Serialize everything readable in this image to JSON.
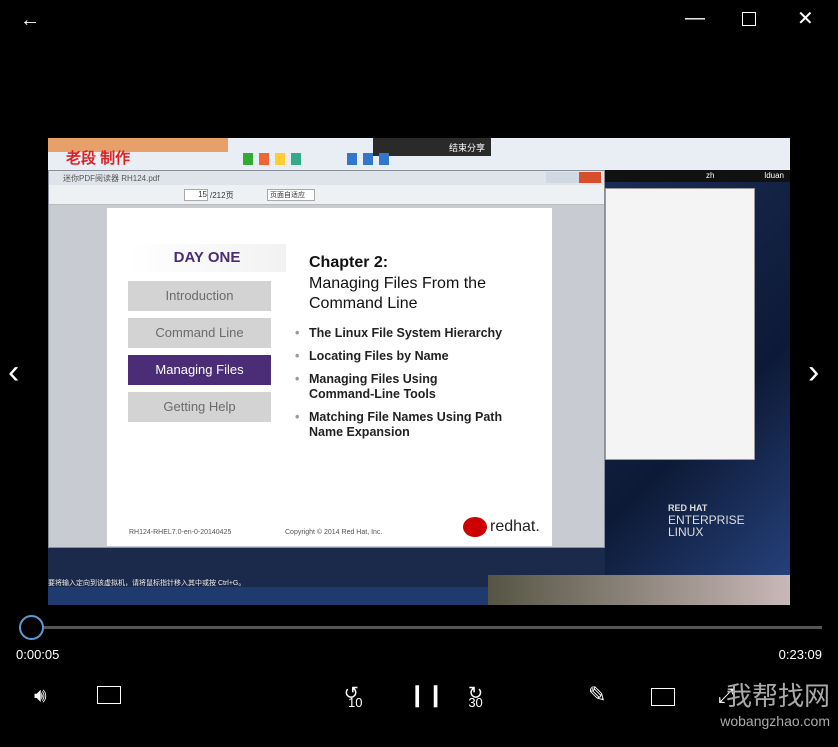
{
  "window": {
    "back_icon": "arrow-left",
    "minimize_icon": "minimize",
    "maximize_icon": "maximize",
    "close_icon": "close"
  },
  "video": {
    "watermark": "老段 制作",
    "share_toolbar": {
      "end_share": "结束分享"
    },
    "pdf_viewer": {
      "title": "迷你PDF阅读器  RH124.pdf",
      "page_current": "15",
      "page_total": "/212页",
      "zoom_mode": "页面自适应"
    },
    "slide": {
      "day_label": "DAY ONE",
      "nav": [
        "Introduction",
        "Command Line",
        "Managing Files",
        "Getting Help"
      ],
      "active_nav": "Managing Files",
      "chapter": "Chapter 2:",
      "title": "Managing Files From the Command Line",
      "bullets": [
        "The Linux File System Hierarchy",
        "Locating Files by Name",
        "Managing Files Using Command-Line Tools",
        "Matching File Names Using Path Name Expansion"
      ],
      "footer_left": "RH124-RHEL7.0-en-0-20140425",
      "footer_center": "Copyright © 2014 Red Hat, Inc.",
      "logo": "redhat."
    },
    "desktop": {
      "lang": "zh",
      "user": "lduan",
      "rhel_logo": [
        "RED HAT",
        "ENTERPRISE",
        "LINUX"
      ]
    },
    "status_text": "要将输入定向到该虚拟机，请将鼠标指针移入其中或按 Ctrl+G。"
  },
  "player": {
    "current_time": "0:00:05",
    "total_time": "0:23:09",
    "progress_fraction": 0.004,
    "accent": "#5b9bd5",
    "skip_back": "10",
    "skip_forward": "30",
    "site_watermark": {
      "name": "我帮找网",
      "url": "wobangzhao.com"
    }
  }
}
